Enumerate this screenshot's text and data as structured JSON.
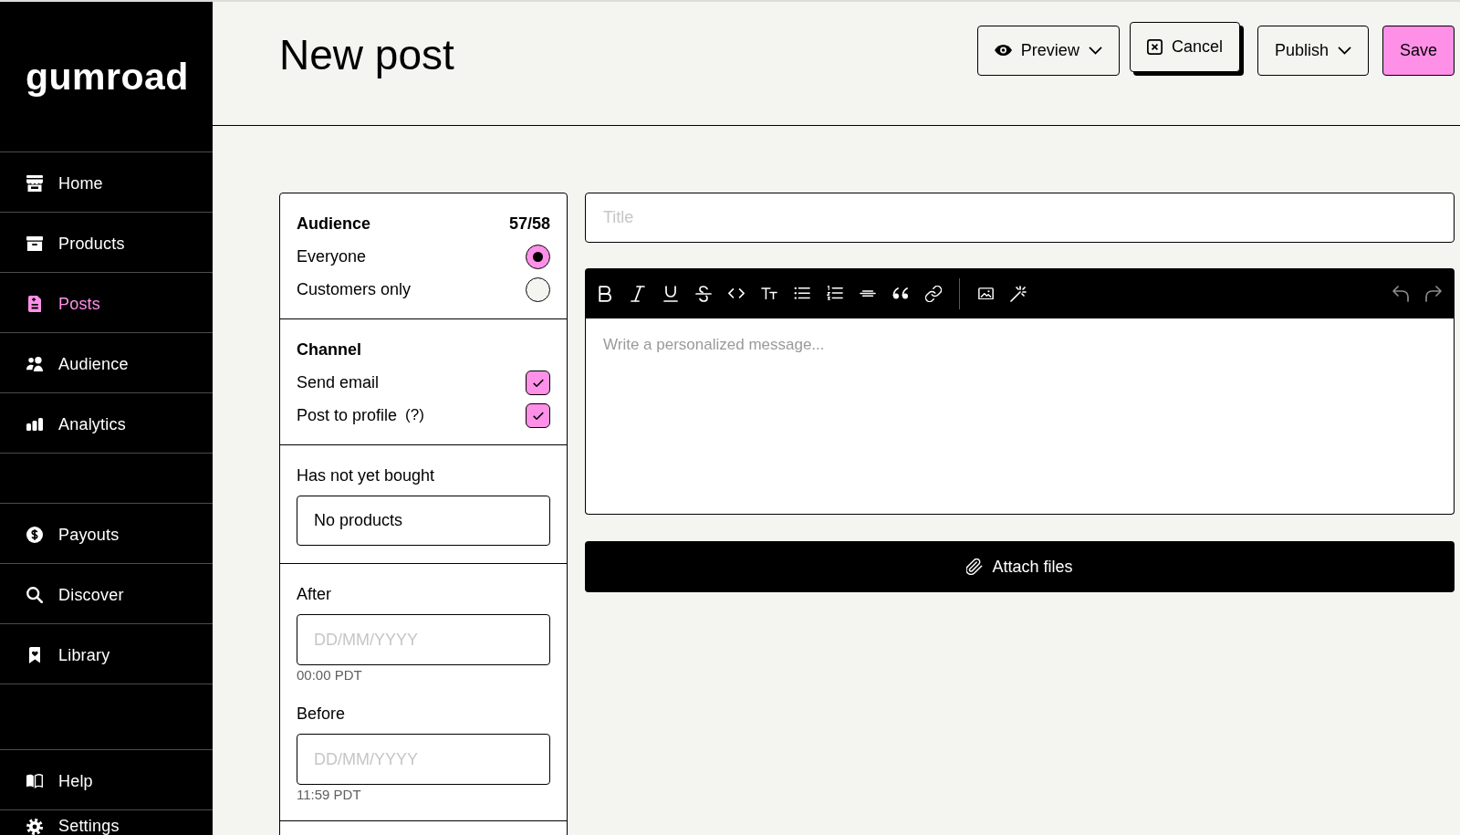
{
  "sidebar": {
    "logo": "gumroad",
    "sections": [
      {
        "items": [
          {
            "label": "Home",
            "selected": false
          },
          {
            "label": "Products",
            "selected": false
          },
          {
            "label": "Posts",
            "selected": true
          },
          {
            "label": "Audience",
            "selected": false
          },
          {
            "label": "Analytics",
            "selected": false
          }
        ]
      },
      {
        "items": [
          {
            "label": "Payouts",
            "selected": false
          },
          {
            "label": "Discover",
            "selected": false
          },
          {
            "label": "Library",
            "selected": false
          }
        ]
      },
      {
        "items": [
          {
            "label": "Help",
            "selected": false
          },
          {
            "label": "Settings",
            "selected": false
          }
        ]
      }
    ]
  },
  "header": {
    "title": "New post",
    "buttons": [
      {
        "kind": "preview",
        "label": "Preview",
        "hovered": false
      },
      {
        "kind": "cancel",
        "label": "Cancel",
        "hovered": true
      },
      {
        "kind": "publish",
        "label": "Publish",
        "hovered": false
      },
      {
        "kind": "save",
        "label": "Save",
        "hovered": false
      }
    ]
  },
  "audience": {
    "title": "Audience",
    "count": "57/58",
    "options": [
      {
        "label": "Everyone",
        "selected": true
      },
      {
        "label": "Customers only",
        "selected": false
      }
    ]
  },
  "channel": {
    "title": "Channel",
    "options": [
      {
        "label": "Send email",
        "checked": true
      },
      {
        "label": "Post to profile",
        "hint": "(?)",
        "checked": true
      }
    ]
  },
  "exclude": {
    "label": "Has not yet bought",
    "value": "No products"
  },
  "date_filters": [
    {
      "label": "After",
      "placeholder": "DD/MM/YYYY",
      "time": "00:00 PDT"
    },
    {
      "label": "Before",
      "placeholder": "DD/MM/YYYY",
      "time": "11:59 PDT"
    }
  ],
  "editor": {
    "title_placeholder": "Title",
    "toolbar": {
      "undo": {
        "disabled": true
      },
      "redo": {
        "disabled": true
      }
    },
    "body_placeholder": "Write a personalized message...",
    "attach_label": "Attach files"
  }
}
